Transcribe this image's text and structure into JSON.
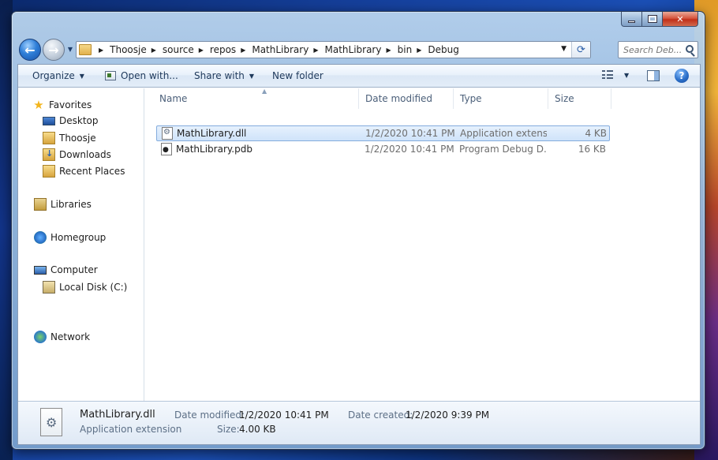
{
  "window": {
    "caption_buttons": {
      "minimize": "minimize",
      "maximize": "maximize",
      "close": "close"
    }
  },
  "navigation": {
    "back_icon": "back-arrow-icon",
    "forward_icon": "forward-arrow-icon",
    "breadcrumbs": [
      "Thoosje",
      "source",
      "repos",
      "MathLibrary",
      "MathLibrary",
      "bin",
      "Debug"
    ],
    "search": {
      "placeholder": "Search Deb...",
      "value": ""
    }
  },
  "toolbar": {
    "organize": "Organize",
    "open_with": "Open with...",
    "share_with": "Share with",
    "new_folder": "New folder"
  },
  "sidebar": {
    "favorites": {
      "label": "Favorites",
      "items": [
        {
          "label": "Desktop",
          "icon": "desktop-icon"
        },
        {
          "label": "Thoosje",
          "icon": "user-folder-icon"
        },
        {
          "label": "Downloads",
          "icon": "downloads-icon"
        },
        {
          "label": "Recent Places",
          "icon": "recent-places-icon"
        }
      ]
    },
    "libraries": "Libraries",
    "homegroup": "Homegroup",
    "computer": {
      "label": "Computer",
      "items": [
        {
          "label": "Local Disk (C:)",
          "icon": "disk-icon"
        }
      ]
    },
    "network": "Network"
  },
  "file_list": {
    "columns": [
      "Name",
      "Date modified",
      "Type",
      "Size"
    ],
    "rows": [
      {
        "name": "MathLibrary.dll",
        "date": "1/2/2020 10:41 PM",
        "type": "Application extens...",
        "size": "4 KB",
        "selected": true,
        "icon": "dll-file-icon"
      },
      {
        "name": "MathLibrary.pdb",
        "date": "1/2/2020 10:41 PM",
        "type": "Program Debug D...",
        "size": "16 KB",
        "selected": false,
        "icon": "pdb-file-icon"
      }
    ]
  },
  "details": {
    "name": "MathLibrary.dll",
    "type": "Application extension",
    "date_modified_label": "Date modified:",
    "date_modified": "1/2/2020 10:41 PM",
    "date_created_label": "Date created:",
    "date_created": "1/2/2020 9:39 PM",
    "size_label": "Size:",
    "size": "4.00 KB"
  }
}
